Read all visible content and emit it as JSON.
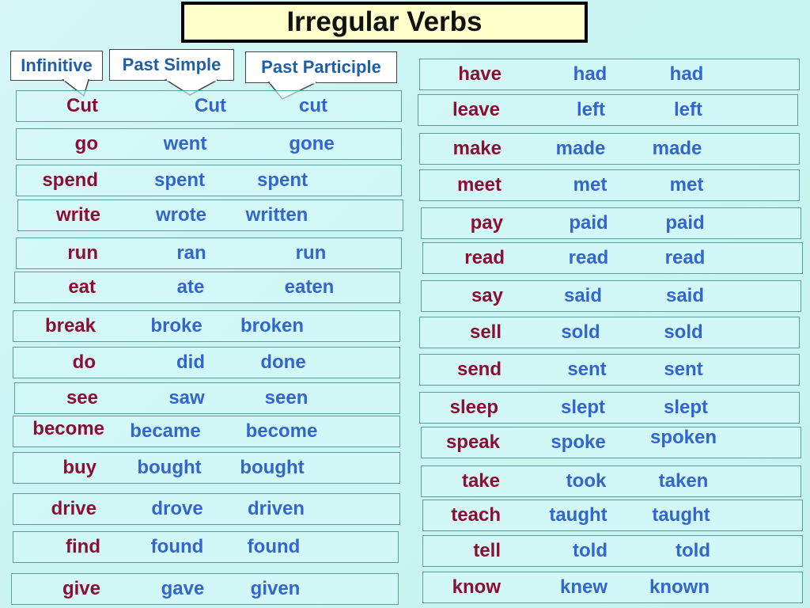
{
  "title": "Irregular Verbs",
  "headers": {
    "infinitive": "Infinitive",
    "past_simple": "Past Simple",
    "past_participle": "Past Participle"
  },
  "colors": {
    "infinitive": "#8b0e35",
    "past_forms": "#3366cc",
    "title_bg": "#ffffcc",
    "background": "#c9f4f2"
  },
  "left_verbs": [
    {
      "inf": "Cut",
      "past": "Cut",
      "pp": "cut"
    },
    {
      "inf": "go",
      "past": "went",
      "pp": "gone"
    },
    {
      "inf": "spend",
      "past": "spent",
      "pp": "spent"
    },
    {
      "inf": "write",
      "past": "wrote",
      "pp": "written"
    },
    {
      "inf": "run",
      "past": "ran",
      "pp": "run"
    },
    {
      "inf": "eat",
      "past": "ate",
      "pp": "eaten"
    },
    {
      "inf": "break",
      "past": "broke",
      "pp": "broken"
    },
    {
      "inf": "do",
      "past": "did",
      "pp": "done"
    },
    {
      "inf": "see",
      "past": "saw",
      "pp": "seen"
    },
    {
      "inf": "become",
      "past": "became",
      "pp": "become"
    },
    {
      "inf": "buy",
      "past": "bought",
      "pp": "bought"
    },
    {
      "inf": "drive",
      "past": "drove",
      "pp": "driven"
    },
    {
      "inf": "find",
      "past": "found",
      "pp": "found"
    },
    {
      "inf": "give",
      "past": "gave",
      "pp": "given"
    }
  ],
  "right_verbs": [
    {
      "inf": "have",
      "past": "had",
      "pp": "had"
    },
    {
      "inf": "leave",
      "past": "left",
      "pp": "left"
    },
    {
      "inf": "make",
      "past": "made",
      "pp": "made"
    },
    {
      "inf": "meet",
      "past": "met",
      "pp": "met"
    },
    {
      "inf": "pay",
      "past": "paid",
      "pp": "paid"
    },
    {
      "inf": "read",
      "past": "read",
      "pp": "read"
    },
    {
      "inf": "say",
      "past": "said",
      "pp": "said"
    },
    {
      "inf": "sell",
      "past": "sold",
      "pp": "sold"
    },
    {
      "inf": "send",
      "past": "sent",
      "pp": "sent"
    },
    {
      "inf": "sleep",
      "past": "slept",
      "pp": "slept"
    },
    {
      "inf": "speak",
      "past": "spoke",
      "pp": "spoken"
    },
    {
      "inf": "take",
      "past": "took",
      "pp": "taken"
    },
    {
      "inf": "teach",
      "past": "taught",
      "pp": "taught"
    },
    {
      "inf": "tell",
      "past": "told",
      "pp": "told"
    },
    {
      "inf": "know",
      "past": "knew",
      "pp": "known"
    }
  ]
}
